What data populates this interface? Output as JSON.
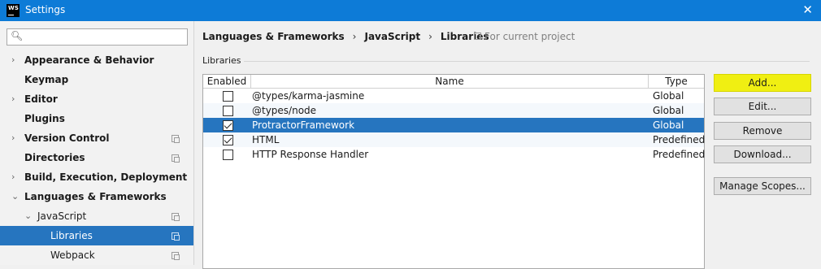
{
  "window": {
    "logo_text": "WS",
    "title": "Settings",
    "close_glyph": "✕"
  },
  "sidebar": {
    "search": {
      "value": "",
      "placeholder": "",
      "icon": "search-icon"
    },
    "items": [
      {
        "label": "Appearance & Behavior",
        "arrow": "›",
        "has_copy": false
      },
      {
        "label": "Keymap",
        "arrow": "",
        "has_copy": false
      },
      {
        "label": "Editor",
        "arrow": "›",
        "has_copy": false
      },
      {
        "label": "Plugins",
        "arrow": "",
        "has_copy": false
      },
      {
        "label": "Version Control",
        "arrow": "›",
        "has_copy": true
      },
      {
        "label": "Directories",
        "arrow": "",
        "has_copy": true
      },
      {
        "label": "Build, Execution, Deployment",
        "arrow": "›",
        "has_copy": false
      },
      {
        "label": "Languages & Frameworks",
        "arrow": "⌄",
        "has_copy": false
      },
      {
        "label": "JavaScript",
        "arrow": "⌄",
        "has_copy": true
      },
      {
        "label": "Libraries",
        "arrow": "",
        "has_copy": true,
        "selected": true
      },
      {
        "label": "Webpack",
        "arrow": "",
        "has_copy": true
      }
    ]
  },
  "main": {
    "breadcrumb": [
      "Languages & Frameworks",
      "JavaScript",
      "Libraries"
    ],
    "breadcrumb_sep": "›",
    "project_note": "For current project",
    "group_label": "Libraries",
    "table": {
      "headers": [
        "Enabled",
        "Name",
        "Type"
      ],
      "rows": [
        {
          "enabled": false,
          "name": "@types/karma-jasmine",
          "type": "Global"
        },
        {
          "enabled": false,
          "name": "@types/node",
          "type": "Global"
        },
        {
          "enabled": true,
          "name": "ProtractorFramework",
          "type": "Global",
          "selected": true
        },
        {
          "enabled": true,
          "name": "HTML",
          "type": "Predefined"
        },
        {
          "enabled": false,
          "name": "HTTP Response Handler",
          "type": "Predefined"
        }
      ]
    },
    "buttons": {
      "add": "Add...",
      "edit": "Edit...",
      "remove": "Remove",
      "download": "Download...",
      "manage_scopes": "Manage Scopes..."
    }
  },
  "colors": {
    "titlebar": "#0d7bd7",
    "selection": "#2675bf",
    "add_highlight": "#f0ef12"
  }
}
